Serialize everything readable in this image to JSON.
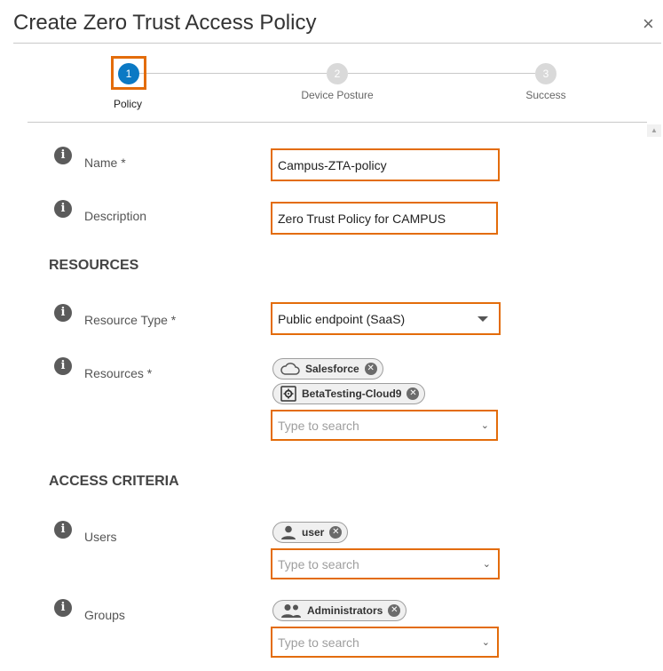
{
  "dialog": {
    "title": "Create Zero Trust Access Policy",
    "close": "×"
  },
  "steps": [
    {
      "number": "1",
      "label": "Policy",
      "active": true
    },
    {
      "number": "2",
      "label": "Device Posture",
      "active": false
    },
    {
      "number": "3",
      "label": "Success",
      "active": false
    }
  ],
  "form": {
    "info_glyph": "i",
    "name": {
      "label": "Name *",
      "value": "Campus-ZTA-policy"
    },
    "description": {
      "label": "Description",
      "value": "Zero Trust Policy for CAMPUS"
    },
    "resources_section": "RESOURCES",
    "resource_type": {
      "label": "Resource Type *",
      "value": "Public endpoint (SaaS)"
    },
    "resources": {
      "label": "Resources *",
      "chips": [
        {
          "label": "Salesforce",
          "icon": "cloud-icon"
        },
        {
          "label": "BetaTesting-Cloud9",
          "icon": "gear-box-icon"
        }
      ],
      "placeholder": "Type to search"
    },
    "access_section": "ACCESS CRITERIA",
    "users": {
      "label": "Users",
      "chips": [
        {
          "label": "user",
          "icon": "person-icon"
        }
      ],
      "placeholder": "Type to search"
    },
    "groups": {
      "label": "Groups",
      "chips": [
        {
          "label": "Administrators",
          "icon": "people-icon"
        }
      ],
      "placeholder": "Type to search"
    }
  },
  "colors": {
    "accent": "#0b79c4",
    "highlight": "#e36c0a"
  }
}
